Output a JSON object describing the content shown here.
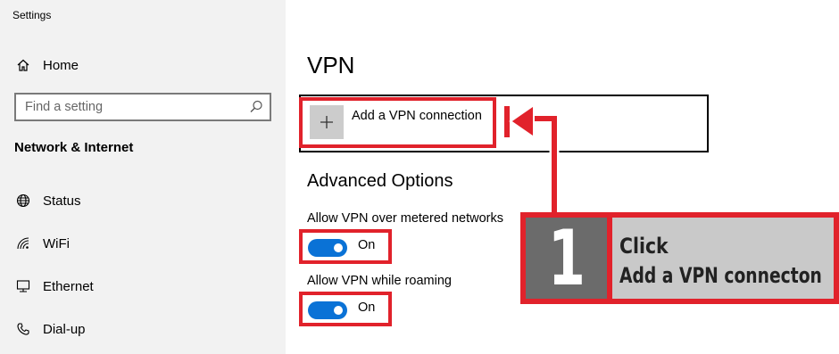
{
  "window": {
    "title": "Settings"
  },
  "sidebar": {
    "home_label": "Home",
    "search_placeholder": "Find a setting",
    "section_title": "Network & Internet",
    "items": [
      {
        "label": "Status",
        "icon": "globe-icon"
      },
      {
        "label": "WiFi",
        "icon": "wifi-icon"
      },
      {
        "label": "Ethernet",
        "icon": "ethernet-icon"
      },
      {
        "label": "Dial-up",
        "icon": "phone-icon"
      }
    ]
  },
  "main": {
    "page_title": "VPN",
    "add_vpn_label": "Add a VPN connection",
    "advanced_title": "Advanced Options",
    "options": [
      {
        "label": "Allow VPN over metered networks",
        "state": "On"
      },
      {
        "label": "Allow VPN while roaming",
        "state": "On"
      }
    ]
  },
  "annotation": {
    "step_number": "1",
    "line1": "Click",
    "line2": "Add a VPN connecton",
    "highlight_color": "#e1222b"
  },
  "colors": {
    "accent": "#0a72d6",
    "sidebar_bg": "#f2f2f2"
  }
}
